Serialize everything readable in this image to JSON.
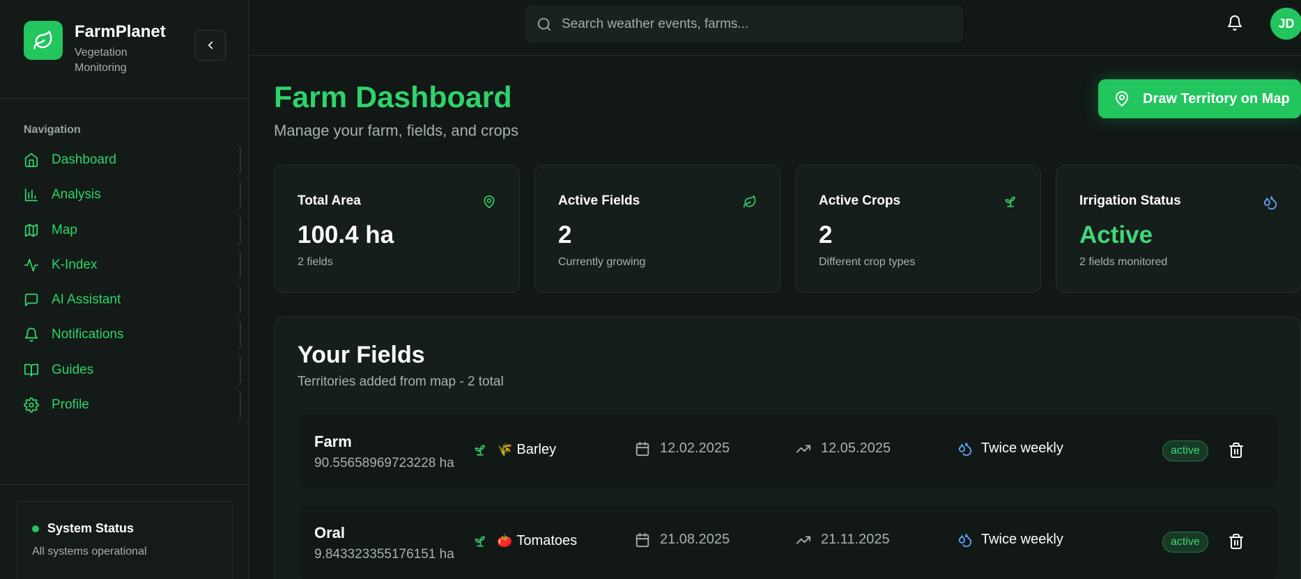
{
  "brand": {
    "name": "FarmPlanet",
    "subtitle": "Vegetation Monitoring"
  },
  "sidebar": {
    "heading": "Navigation",
    "items": [
      {
        "label": "Dashboard",
        "icon": "home-icon"
      },
      {
        "label": "Analysis",
        "icon": "bar-chart-icon"
      },
      {
        "label": "Map",
        "icon": "map-icon"
      },
      {
        "label": "K-Index",
        "icon": "activity-icon"
      },
      {
        "label": "AI Assistant",
        "icon": "message-icon"
      },
      {
        "label": "Notifications",
        "icon": "bell-icon"
      },
      {
        "label": "Guides",
        "icon": "book-icon"
      },
      {
        "label": "Profile",
        "icon": "settings-icon"
      }
    ],
    "system_status": {
      "title": "System Status",
      "text": "All systems operational"
    }
  },
  "topbar": {
    "search_placeholder": "Search weather events, farms...",
    "avatar_initials": "JD"
  },
  "header": {
    "title": "Farm Dashboard",
    "subtitle": "Manage your farm, fields, and crops",
    "draw_button": "Draw Territory on Map"
  },
  "stats": [
    {
      "title": "Total Area",
      "value": "100.4 ha",
      "sub": "2 fields",
      "icon": "map-pin-icon"
    },
    {
      "title": "Active Fields",
      "value": "2",
      "sub": "Currently growing",
      "icon": "leaf-icon"
    },
    {
      "title": "Active Crops",
      "value": "2",
      "sub": "Different crop types",
      "icon": "sprout-icon"
    },
    {
      "title": "Irrigation Status",
      "value": "Active",
      "sub": "2 fields monitored",
      "icon": "droplets-icon"
    }
  ],
  "fields": {
    "title": "Your Fields",
    "subtitle": "Territories added from map - 2 total",
    "rows": [
      {
        "name": "Farm",
        "area": "90.55658969723228 ha",
        "crop_emoji": "🌾",
        "crop": "Barley",
        "planted": "12.02.2025",
        "harvest": "12.05.2025",
        "irrigation": "Twice weekly",
        "status": "active"
      },
      {
        "name": "Oral",
        "area": "9.843323355176151 ha",
        "crop_emoji": "🍅",
        "crop": "Tomatoes",
        "planted": "21.08.2025",
        "harvest": "21.11.2025",
        "irrigation": "Twice weekly",
        "status": "active"
      }
    ]
  },
  "colors": {
    "accent": "#22c55e",
    "accent_text": "#2fd36b",
    "background": "#111816",
    "card": "#161e1b",
    "irrigation_icon": "#60a5fa"
  }
}
